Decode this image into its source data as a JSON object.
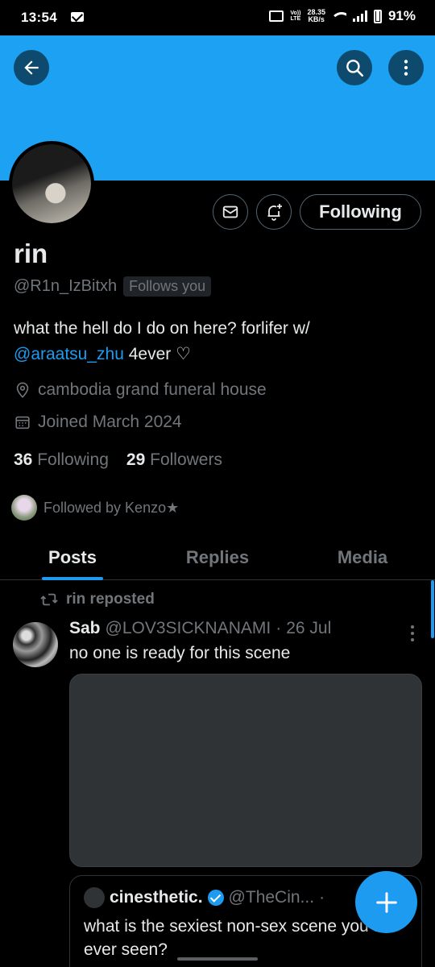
{
  "status_bar": {
    "time": "13:54",
    "volte_top": "Vo))",
    "volte_bottom": "LTE",
    "net_speed_value": "28.35",
    "net_speed_unit": "KB/s",
    "battery": "91%"
  },
  "profile": {
    "display_name": "rin",
    "handle": "@R1n_IzBitxh",
    "follows_you_badge": "Follows you",
    "bio_text": "what the hell do I do on here? forlifer w/",
    "bio_mention": "@araatsu_zhu",
    "bio_suffix": " 4ever ♡",
    "location": "cambodia grand funeral house",
    "joined": "Joined March 2024",
    "following_count": "36",
    "following_label": "Following",
    "followers_count": "29",
    "followers_label": "Followers",
    "followed_by": "Followed by Kenzo★",
    "following_button": "Following"
  },
  "tabs": [
    {
      "label": "Posts",
      "active": true
    },
    {
      "label": "Replies",
      "active": false
    },
    {
      "label": "Media",
      "active": false
    }
  ],
  "post": {
    "repost_label": "rin reposted",
    "author_name": "Sab",
    "author_handle": "@LOV3SICKNANAMI",
    "separator": "·",
    "date": "26 Jul",
    "text": "no one is ready for this scene",
    "quote": {
      "name": "cinesthetic.",
      "handle": "@TheCin...",
      "separator": "·",
      "text": "what is the sexiest non-sex scene you've ever seen?"
    }
  },
  "icons": {
    "back": "arrow-left-icon",
    "search": "search-icon",
    "more": "more-vertical-icon",
    "dm": "mail-icon",
    "notify": "bell-plus-icon",
    "location": "location-pin-icon",
    "calendar": "calendar-icon",
    "repost": "repost-icon",
    "compose": "plus-icon",
    "verified": "verified-badge-icon"
  },
  "colors": {
    "banner": "#1da1f2",
    "accent": "#1d9bf0",
    "background": "#000000",
    "muted_text": "#71767b"
  }
}
